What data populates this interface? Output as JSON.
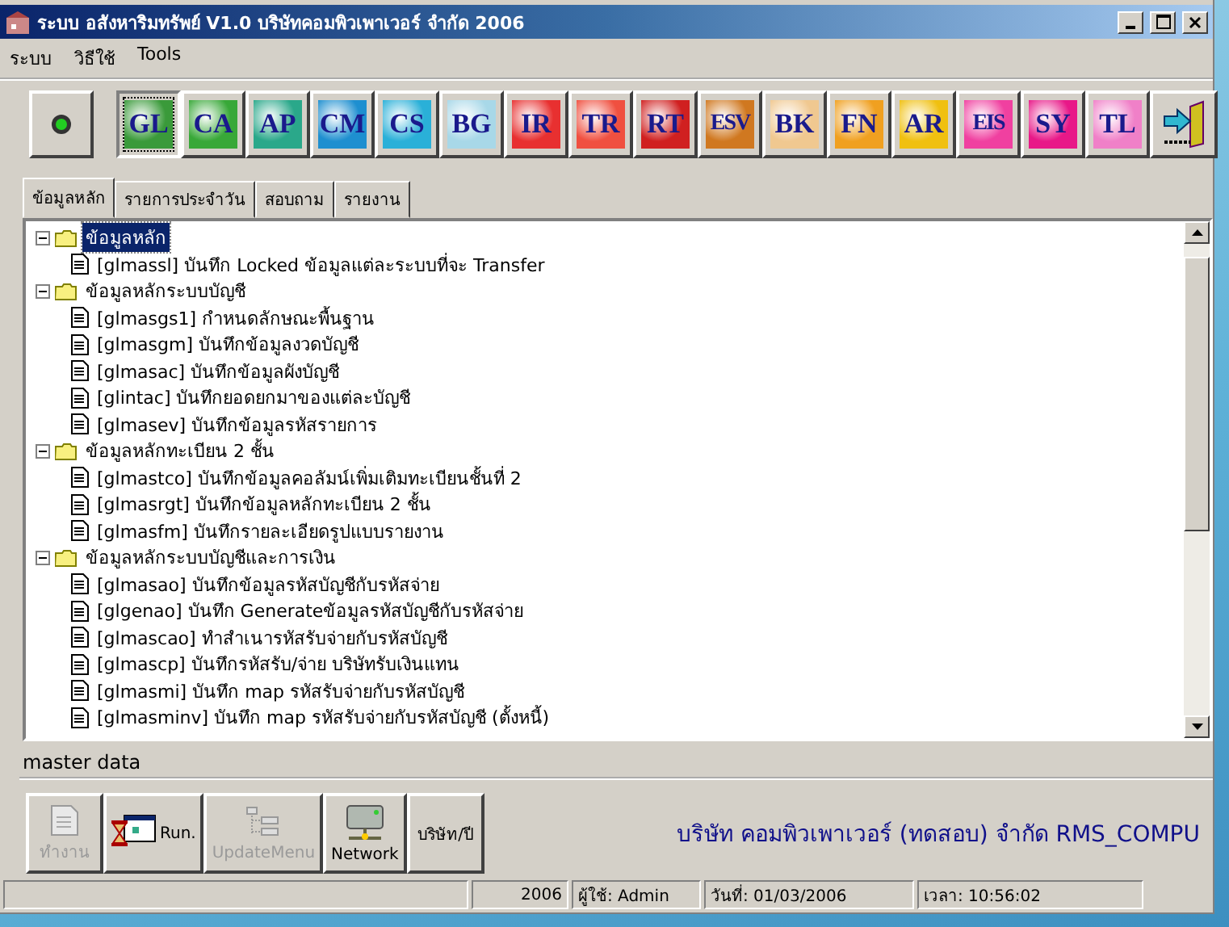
{
  "window": {
    "title": "ระบบ อสังหาริมทรัพย์ V1.0 บริษัทคอมพิวเพาเวอร์ จำกัด 2006"
  },
  "menu": [
    "ระบบ",
    "วิธีใช้",
    "Tools"
  ],
  "modules": [
    {
      "label": "GL",
      "color": "#3a9a3a",
      "selected": true
    },
    {
      "label": "CA",
      "color": "#38a838",
      "selected": false
    },
    {
      "label": "AP",
      "color": "#2aa88a",
      "selected": false
    },
    {
      "label": "CM",
      "color": "#1e8fd0",
      "selected": false
    },
    {
      "label": "CS",
      "color": "#2ab0d8",
      "selected": false
    },
    {
      "label": "BG",
      "color": "#a8d8e8",
      "selected": false
    },
    {
      "label": "IR",
      "color": "#e83030",
      "selected": false
    },
    {
      "label": "TR",
      "color": "#f05040",
      "selected": false
    },
    {
      "label": "RT",
      "color": "#d02020",
      "selected": false
    },
    {
      "label": "ESV",
      "color": "#d07820",
      "selected": false
    },
    {
      "label": "BK",
      "color": "#f0c890",
      "selected": false
    },
    {
      "label": "FN",
      "color": "#f0a020",
      "selected": false
    },
    {
      "label": "AR",
      "color": "#f0c010",
      "selected": false
    },
    {
      "label": "EIS",
      "color": "#f040a0",
      "selected": false
    },
    {
      "label": "SY",
      "color": "#e81888",
      "selected": false
    },
    {
      "label": "TL",
      "color": "#f080c8",
      "selected": false
    }
  ],
  "tabs": [
    {
      "label": "ข้อมูลหลัก",
      "selected": true
    },
    {
      "label": "รายการประจำวัน",
      "selected": false
    },
    {
      "label": "สอบถาม",
      "selected": false
    },
    {
      "label": "รายงาน",
      "selected": false
    }
  ],
  "tree": [
    {
      "label": "ข้อมูลหลัก",
      "selected": true,
      "expanded": true,
      "children": [
        {
          "label": "[glmassl]  บันทึก Locked ข้อมูลแต่ละระบบที่จะ Transfer",
          "selected": false
        }
      ]
    },
    {
      "label": "ข้อมูลหลักระบบบัญชี",
      "selected": false,
      "expanded": true,
      "children": [
        {
          "label": "[glmasgs1]  กำหนดลักษณะพื้นฐาน",
          "selected": false
        },
        {
          "label": "[glmasgm]  บันทึกข้อมูลงวดบัญชี",
          "selected": false
        },
        {
          "label": "[glmasac]  บันทึกข้อมูลผังบัญชี",
          "selected": false
        },
        {
          "label": "[glintac]  บันทึกยอดยกมาของแต่ละบัญชี",
          "selected": false
        },
        {
          "label": "[glmasev]  บันทึกข้อมูลรหัสรายการ",
          "selected": false
        }
      ]
    },
    {
      "label": "ข้อมูลหลักทะเบียน 2 ชั้น",
      "selected": false,
      "expanded": true,
      "children": [
        {
          "label": "[glmastco]  บันทึกข้อมูลคอลัมน์เพิ่มเติมทะเบียนชั้นที่ 2",
          "selected": false
        },
        {
          "label": "[glmasrgt]  บันทึกข้อมูลหลักทะเบียน 2 ชั้น",
          "selected": false
        },
        {
          "label": "[glmasfm]  บันทึกรายละเอียดรูปแบบรายงาน",
          "selected": false
        }
      ]
    },
    {
      "label": "ข้อมูลหลักระบบบัญชีและการเงิน",
      "selected": false,
      "expanded": true,
      "children": [
        {
          "label": "[glmasao]  บันทึกข้อมูลรหัสบัญชีกับรหัสจ่าย",
          "selected": false
        },
        {
          "label": "[glgenao]  บันทึก Generateข้อมูลรหัสบัญชีกับรหัสจ่าย",
          "selected": false
        },
        {
          "label": "[glmascao]  ทำสำเนารหัสรับจ่ายกับรหัสบัญชี",
          "selected": false
        },
        {
          "label": "[glmascp]  บันทึกรหัสรับ/จ่าย บริษัทรับเงินแทน",
          "selected": false
        },
        {
          "label": "[glmasmi]  บันทึก map รหัสรับจ่ายกับรหัสบัญชี",
          "selected": false
        },
        {
          "label": "[glmasminv]  บันทึก map รหัสรับจ่ายกับรหัสบัญชี (ตั้งหนี้)",
          "selected": false
        }
      ]
    }
  ],
  "description": "master data",
  "actions": [
    {
      "kind": "work",
      "label": "ทำงาน",
      "disabled": true
    },
    {
      "kind": "run",
      "label": "Run.",
      "disabled": false
    },
    {
      "kind": "menu",
      "label": "UpdateMenu",
      "disabled": true
    },
    {
      "kind": "network",
      "label": "Network",
      "disabled": false
    },
    {
      "kind": "company",
      "label": "บริษัท/ปี",
      "disabled": false
    }
  ],
  "company": "บริษัท คอมพิวเพาเวอร์ (ทดสอบ) จำกัด RMS_COMPU",
  "status_bar": [
    "2006",
    "ผู้ใช้: Admin",
    "วันที่: 01/03/2006",
    "เวลา: 10:56:02"
  ]
}
